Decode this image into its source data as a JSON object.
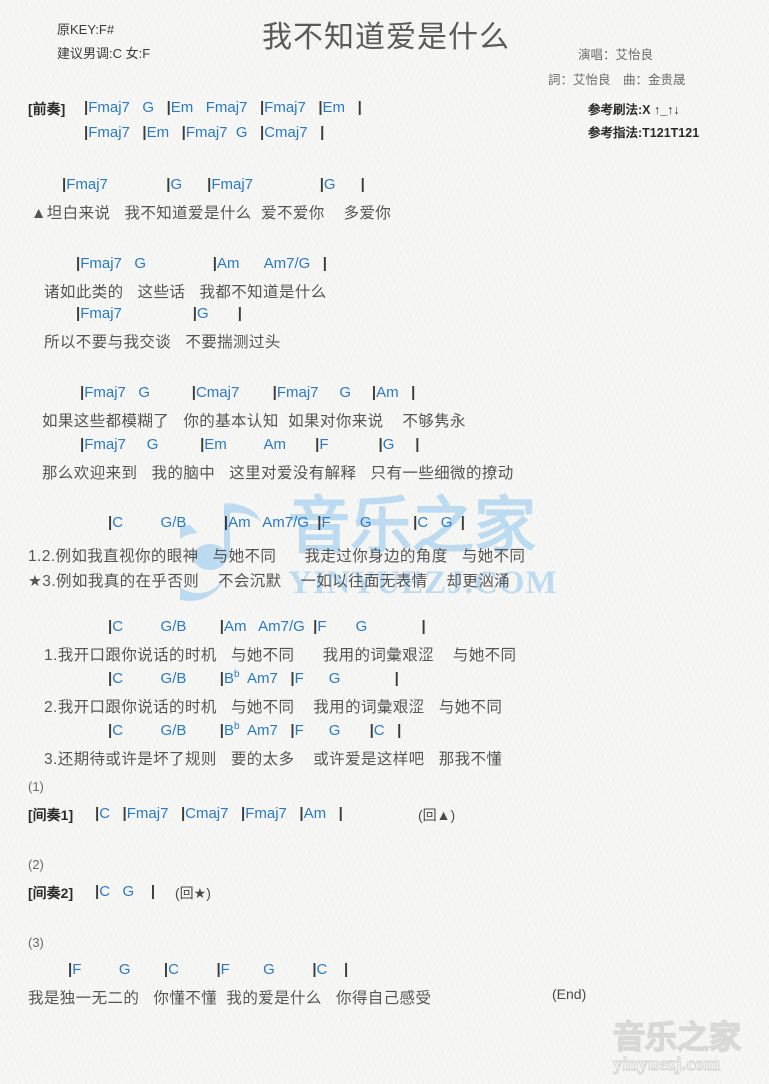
{
  "header": {
    "original_key": "原KEY:F#",
    "suggested_key": "建议男调:C 女:F",
    "title": "我不知道爱是什么",
    "singer": "演唱：艾怡良",
    "writer": "詞：艾怡良　曲：金贵晟",
    "strum_pattern": "参考刷法:X ↑_↑↓",
    "finger_pattern": "参考指法:T121T121"
  },
  "colors": {
    "chord": "#2a7ac4",
    "lyric": "#555555",
    "bar": "#3b3b3b",
    "watermark": "#8ec6ee",
    "page_bg": "#f7f7f5"
  },
  "watermark": {
    "logo_text": "音乐之家",
    "site_text": "YINYUEZJ.COM",
    "corner_logo_text": "音乐之家",
    "corner_site_text": "yinyuezj.com"
  },
  "intro": {
    "label": "[前奏]",
    "line1": "|Fmaj7   G   |Em   Fmaj7   |Fmaj7   |Em   |",
    "line2": "|Fmaj7   |Em   |Fmaj7  G   |Cmaj7   |"
  },
  "sections": [
    {
      "name": "verse-a",
      "rows": [
        {
          "type": "chord",
          "text": "|Fmaj7              |G      |Fmaj7                |G      |"
        },
        {
          "type": "lyric",
          "text": "▲坦白来说   我不知道爱是什么  爱不爱你    多爱你"
        }
      ]
    },
    {
      "name": "verse-b",
      "rows": [
        {
          "type": "chord",
          "text": "|Fmaj7   G                |Am      Am7/G   |"
        },
        {
          "type": "lyric",
          "text": "诸如此类的   这些话   我都不知道是什么"
        },
        {
          "type": "chord",
          "text": "|Fmaj7                 |G       |"
        },
        {
          "type": "lyric",
          "text": "所以不要与我交谈   不要揣测过头"
        }
      ]
    },
    {
      "name": "verse-c",
      "rows": [
        {
          "type": "chord",
          "text": "|Fmaj7   G          |Cmaj7        |Fmaj7     G     |Am   |"
        },
        {
          "type": "lyric",
          "text": "如果这些都模糊了   你的基本认知  如果对你来说    不够隽永"
        },
        {
          "type": "chord",
          "text": "|Fmaj7     G          |Em         Am       |F            |G     |"
        },
        {
          "type": "lyric",
          "text": "那么欢迎来到   我的脑中   这里对爱没有解释   只有一些细微的撩动"
        }
      ]
    },
    {
      "name": "chorus-star",
      "rows": [
        {
          "type": "chord",
          "text": "|C         G/B         |Am   Am7/G  |F       G          |C   G  |"
        },
        {
          "type": "lyric",
          "text": "1.2.例如我直视你的眼神   与她不同      我走过你身边的角度   与她不同"
        },
        {
          "type": "lyric",
          "text": "★3.例如我真的在乎否则    不会沉默    一如以往面无表情    却更汹涌"
        }
      ]
    },
    {
      "name": "numbered-verses",
      "rows": [
        {
          "type": "chord",
          "text": "|C         G/B        |Am   Am7/G  |F       G             |"
        },
        {
          "type": "lyric",
          "text": "1.我开口跟你说话的时机   与她不同      我用的词彙艰涩    与她不同"
        },
        {
          "type": "chord",
          "text": "|C         G/B        |B♭  Am7   |F      G             |"
        },
        {
          "type": "lyric",
          "text": "2.我开口跟你说话的时机   与她不同    我用的词彙艰涩   与她不同"
        },
        {
          "type": "chord",
          "text": "|C         G/B        |B♭  Am7   |F      G       |C   |"
        },
        {
          "type": "lyric",
          "text": "3.还期待或许是坏了规则   要的太多    或许爱是这样吧   那我不懂"
        }
      ]
    }
  ],
  "interludes": [
    {
      "num": "(1)",
      "label": "[间奏1]",
      "chords": "|C   |Fmaj7   |Cmaj7   |Fmaj7   |Am   |",
      "repeat": "(回▲)"
    },
    {
      "num": "(2)",
      "label": "[间奏2]",
      "chords": "|C   G    |",
      "repeat": "(回★)"
    }
  ],
  "ending": {
    "num": "(3)",
    "chord_line": "|F         G        |C         |F        G         |C    |",
    "lyric_line": "我是独一无二的   你懂不懂  我的爱是什么   你得自己感受",
    "end_marker": "(End)"
  }
}
